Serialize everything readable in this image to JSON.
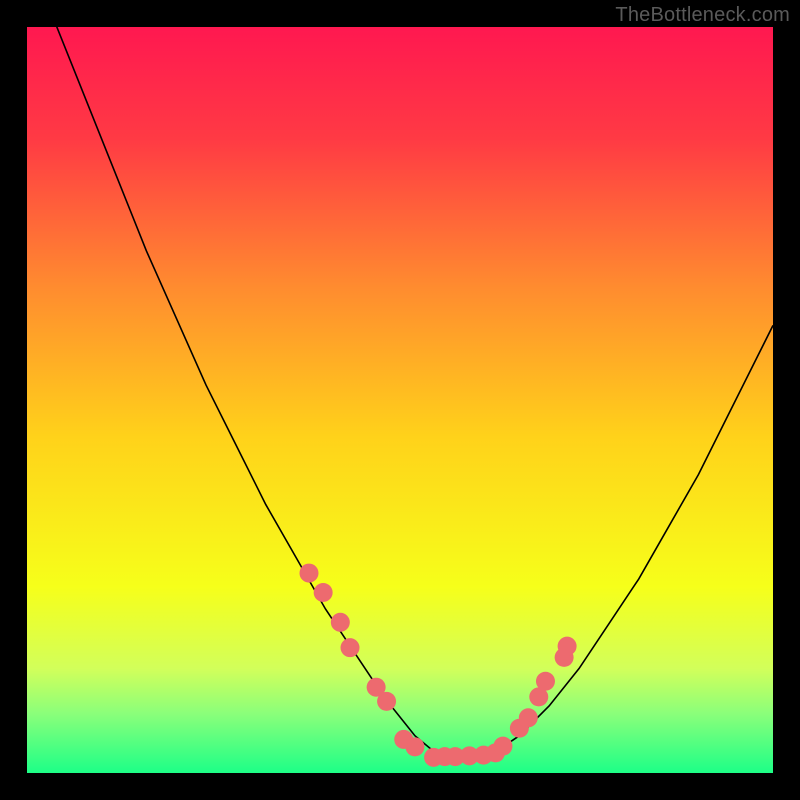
{
  "watermark": "TheBottleneck.com",
  "chart_data": {
    "type": "line",
    "title": "",
    "xlabel": "",
    "ylabel": "",
    "xlim": [
      0,
      100
    ],
    "ylim": [
      0,
      100
    ],
    "grid": false,
    "legend": false,
    "background": {
      "type": "vertical-gradient",
      "stops": [
        {
          "pos": 0.0,
          "color": "#ff1850"
        },
        {
          "pos": 0.15,
          "color": "#ff3a44"
        },
        {
          "pos": 0.35,
          "color": "#ff8c2f"
        },
        {
          "pos": 0.55,
          "color": "#ffd21a"
        },
        {
          "pos": 0.75,
          "color": "#f6ff1a"
        },
        {
          "pos": 0.86,
          "color": "#d2ff5a"
        },
        {
          "pos": 0.92,
          "color": "#8bff7a"
        },
        {
          "pos": 1.0,
          "color": "#1dff87"
        }
      ]
    },
    "series": [
      {
        "name": "bottleneck-curve",
        "type": "line",
        "color": "#000000",
        "width": 1.6,
        "x": [
          0,
          4,
          8,
          12,
          16,
          20,
          24,
          28,
          32,
          36,
          40,
          44,
          48,
          52,
          55,
          58,
          62,
          66,
          70,
          74,
          78,
          82,
          86,
          90,
          94,
          98,
          100
        ],
        "y": [
          113,
          100,
          90,
          80,
          70,
          61,
          52,
          44,
          36,
          29,
          22,
          16,
          10,
          5,
          2.5,
          1.8,
          2.3,
          5,
          9,
          14,
          20,
          26,
          33,
          40,
          48,
          56,
          60
        ]
      },
      {
        "name": "left-branch-markers",
        "type": "scatter",
        "color": "#ed6a6f",
        "size": 19,
        "x": [
          37.8,
          39.7,
          42.0,
          43.3,
          46.8,
          48.2
        ],
        "y": [
          26.8,
          24.2,
          20.2,
          16.8,
          11.5,
          9.6
        ]
      },
      {
        "name": "right-branch-markers",
        "type": "scatter",
        "color": "#ed6a6f",
        "size": 19,
        "x": [
          66.0,
          67.2,
          68.6,
          69.5,
          72.0,
          72.4
        ],
        "y": [
          6.0,
          7.4,
          10.2,
          12.3,
          15.5,
          17.0
        ]
      },
      {
        "name": "valley-markers",
        "type": "scatter",
        "color": "#ed6a6f",
        "size": 19,
        "x": [
          50.5,
          52.0,
          54.5,
          56.0,
          57.4,
          59.3,
          61.2,
          62.8,
          63.8
        ],
        "y": [
          4.5,
          3.5,
          2.1,
          2.2,
          2.2,
          2.3,
          2.4,
          2.7,
          3.6
        ]
      }
    ]
  }
}
